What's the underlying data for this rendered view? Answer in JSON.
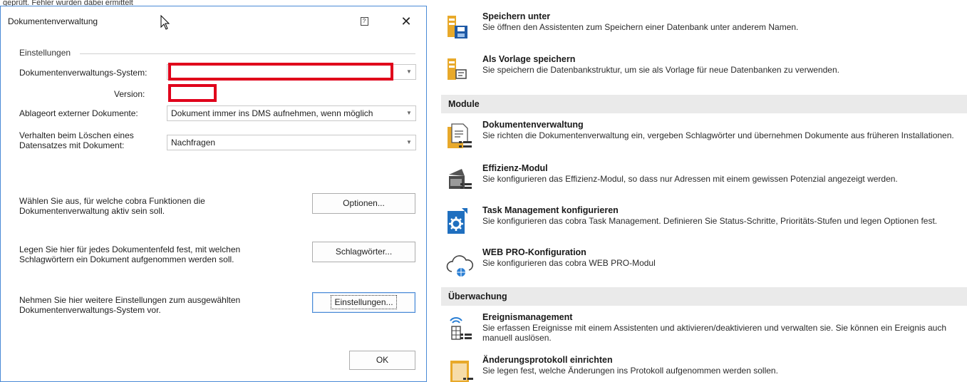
{
  "background": {
    "top_strip_text": "geprüft. Fehler wurden dabei ermittelt",
    "entries": [
      {
        "title": "Speichern unter",
        "desc": "Sie öffnen den Assistenten zum Speichern einer Datenbank unter anderem Namen.",
        "icon": "save-as-icon"
      },
      {
        "title": "Als Vorlage speichern",
        "desc": "Sie speichern die Datenbankstruktur, um sie als Vorlage für neue Datenbanken zu verwenden.",
        "icon": "template-icon"
      }
    ],
    "sections": [
      {
        "label": "Module",
        "entries": [
          {
            "title": "Dokumentenverwaltung",
            "desc": "Sie richten die Dokumentenverwaltung ein, vergeben Schlagwörter und übernehmen Dokumente aus früheren Installationen.",
            "icon": "document-management-icon"
          },
          {
            "title": "Effizienz-Modul",
            "desc": "Sie konfigurieren das Effizienz-Modul, so dass nur Adressen mit einem gewissen Potenzial angezeigt werden.",
            "icon": "efficiency-icon"
          },
          {
            "title": "Task Management konfigurieren",
            "desc": "Sie konfigurieren das cobra Task Management. Definieren Sie Status-Schritte, Prioritäts-Stufen und legen Optionen fest.",
            "icon": "task-gear-icon"
          },
          {
            "title": "WEB PRO-Konfiguration",
            "desc": "Sie konfigurieren das cobra WEB PRO-Modul",
            "icon": "cloud-globe-icon"
          }
        ]
      },
      {
        "label": "Überwachung",
        "entries": [
          {
            "title": "Ereignismanagement",
            "desc": "Sie erfassen Ereignisse mit einem Assistenten und aktivieren/deaktivieren und verwalten sie. Sie können ein Ereignis auch manuell auslösen.",
            "icon": "event-icon"
          },
          {
            "title": "Änderungsprotokoll einrichten",
            "desc": "Sie legen fest, welche Änderungen ins Protokoll aufgenommen werden sollen.",
            "icon": "changelog-icon"
          }
        ]
      }
    ]
  },
  "dialog": {
    "title": "Dokumentenverwaltung",
    "help_symbol": "?",
    "close_symbol": "✕",
    "group_label": "Einstellungen",
    "fields": {
      "dms_label": "Dokumentenverwaltungs-System:",
      "dms_value": "",
      "version_label": "Version:",
      "version_value": "",
      "storage_label": "Ablageort externer Dokumente:",
      "storage_value": "Dokument immer ins DMS aufnehmen, wenn möglich",
      "delete_label": "Verhalten beim Löschen eines Datensatzes mit Dokument:",
      "delete_value": "Nachfragen"
    },
    "actions": [
      {
        "text": "Wählen Sie aus, für welche cobra Funktionen die Dokumentenverwaltung aktiv sein soll.",
        "button": "Optionen..."
      },
      {
        "text": "Legen Sie hier für jedes Dokumentenfeld fest, mit welchen Schlagwörtern ein Dokument aufgenommen werden soll.",
        "button": "Schlagwörter..."
      },
      {
        "text": "Nehmen Sie hier weitere Einstellungen zum ausgewählten Dokumentenverwaltungs-System vor.",
        "button": "Einstellungen..."
      }
    ],
    "ok_label": "OK"
  }
}
